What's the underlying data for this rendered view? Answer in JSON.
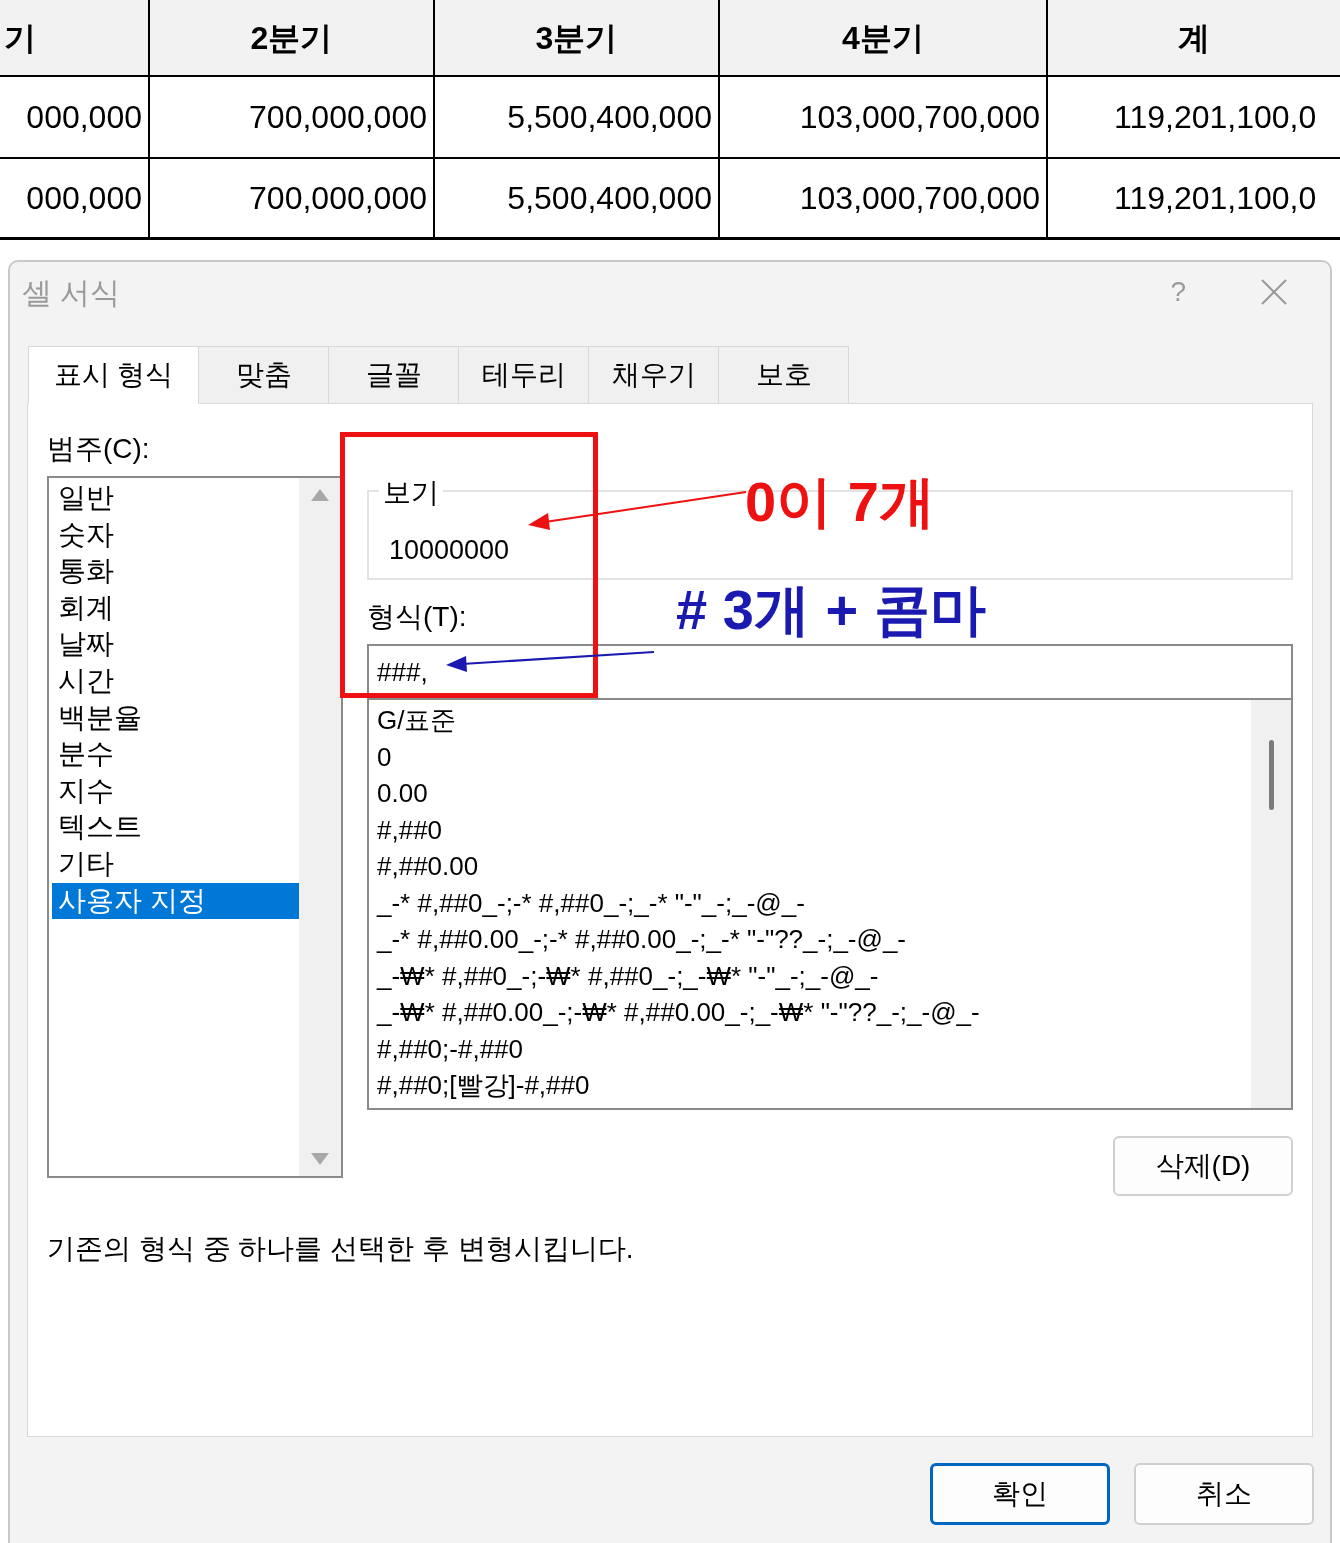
{
  "table": {
    "headers": [
      "기",
      "2분기",
      "3분기",
      "4분기",
      "계"
    ],
    "rows": [
      [
        "000,000",
        "700,000,000",
        "5,500,400,000",
        "103,000,700,000",
        "119,201,100,0"
      ],
      [
        "000,000",
        "700,000,000",
        "5,500,400,000",
        "103,000,700,000",
        "119,201,100,0"
      ]
    ]
  },
  "dialog": {
    "title": "셀 서식",
    "help": "?",
    "tabs": [
      {
        "label": "표시 형식",
        "selected": true
      },
      {
        "label": "맞춤",
        "selected": false
      },
      {
        "label": "글꼴",
        "selected": false
      },
      {
        "label": "테두리",
        "selected": false
      },
      {
        "label": "채우기",
        "selected": false
      },
      {
        "label": "보호",
        "selected": false
      }
    ],
    "category_label": "범주(C):",
    "categories": [
      {
        "label": "일반",
        "selected": false
      },
      {
        "label": "숫자",
        "selected": false
      },
      {
        "label": "통화",
        "selected": false
      },
      {
        "label": "회계",
        "selected": false
      },
      {
        "label": "날짜",
        "selected": false
      },
      {
        "label": "시간",
        "selected": false
      },
      {
        "label": "백분율",
        "selected": false
      },
      {
        "label": "분수",
        "selected": false
      },
      {
        "label": "지수",
        "selected": false
      },
      {
        "label": "텍스트",
        "selected": false
      },
      {
        "label": "기타",
        "selected": false
      },
      {
        "label": "사용자 지정",
        "selected": true
      }
    ],
    "preview": {
      "label": "보기",
      "value": "10000000"
    },
    "format_label": "형식(T):",
    "format_value": "###,",
    "formats": [
      "G/표준",
      "0",
      "0.00",
      "#,##0",
      "#,##0.00",
      "_-* #,##0_-;-* #,##0_-;_-* \"-\"_-;_-@_-",
      "_-* #,##0.00_-;-* #,##0.00_-;_-* \"-\"??_-;_-@_-",
      "_-₩* #,##0_-;-₩* #,##0_-;_-₩* \"-\"_-;_-@_-",
      "_-₩* #,##0.00_-;-₩* #,##0.00_-;_-₩* \"-\"??_-;_-@_-",
      "#,##0;-#,##0",
      "#,##0;[빨강]-#,##0"
    ],
    "delete_button": "삭제(D)",
    "description": "기존의 형식 중 하나를 선택한 후 변형시킵니다.",
    "buttons": [
      {
        "label": "확인",
        "default": true
      },
      {
        "label": "취소",
        "default": false
      }
    ]
  },
  "annotations": [
    {
      "text": "0이 7개",
      "color": "#ee1111"
    },
    {
      "text": "# 3개 + 콤마",
      "color": "#1a1ab0"
    }
  ]
}
